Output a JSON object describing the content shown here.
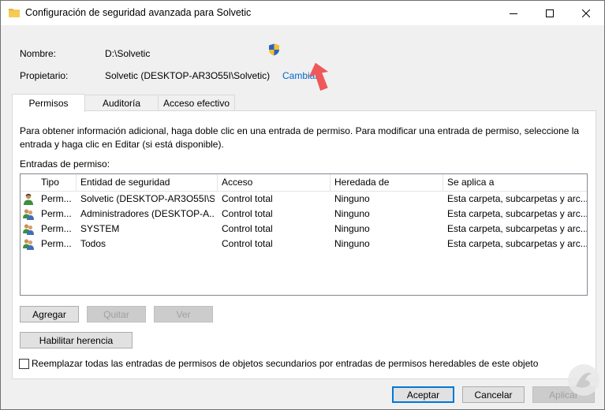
{
  "window": {
    "title": "Configuración de seguridad avanzada para Solvetic"
  },
  "info": {
    "name_label": "Nombre:",
    "name_value": "D:\\Solvetic",
    "owner_label": "Propietario:",
    "owner_value": "Solvetic (DESKTOP-AR3O55I\\Solvetic)",
    "change_link": "Cambiar"
  },
  "tabs": [
    {
      "label": "Permisos",
      "active": true
    },
    {
      "label": "Auditoría",
      "active": false
    },
    {
      "label": "Acceso efectivo",
      "active": false
    }
  ],
  "permisos": {
    "description": "Para obtener información adicional, haga doble clic en una entrada de permiso. Para modificar una entrada de permiso, seleccione la entrada y haga clic en Editar (si está disponible).",
    "entries_label": "Entradas de permiso:",
    "columns": [
      "Tipo",
      "Entidad de seguridad",
      "Acceso",
      "Heredada de",
      "Se aplica a"
    ],
    "rows": [
      {
        "icon": "user-icon",
        "type": "Perm...",
        "principal": "Solvetic (DESKTOP-AR3O55I\\S...",
        "access": "Control total",
        "inherited": "Ninguno",
        "applies": "Esta carpeta, subcarpetas y arc..."
      },
      {
        "icon": "group-icon",
        "type": "Perm...",
        "principal": "Administradores (DESKTOP-A...",
        "access": "Control total",
        "inherited": "Ninguno",
        "applies": "Esta carpeta, subcarpetas y arc..."
      },
      {
        "icon": "group-icon",
        "type": "Perm...",
        "principal": "SYSTEM",
        "access": "Control total",
        "inherited": "Ninguno",
        "applies": "Esta carpeta, subcarpetas y arc..."
      },
      {
        "icon": "group-icon",
        "type": "Perm...",
        "principal": "Todos",
        "access": "Control total",
        "inherited": "Ninguno",
        "applies": "Esta carpeta, subcarpetas y arc..."
      }
    ],
    "buttons": {
      "add": "Agregar",
      "remove": "Quitar",
      "view": "Ver",
      "enable_inheritance": "Habilitar herencia"
    },
    "replace_checkbox": {
      "label": "Reemplazar todas las entradas de permisos de objetos secundarios por entradas de permisos heredables de este objeto",
      "checked": false
    }
  },
  "footer": {
    "accept": "Aceptar",
    "cancel": "Cancelar",
    "apply": "Aplicar"
  },
  "colors": {
    "link": "#0066cc",
    "arrow": "#f0575b",
    "accent": "#0078d7"
  }
}
